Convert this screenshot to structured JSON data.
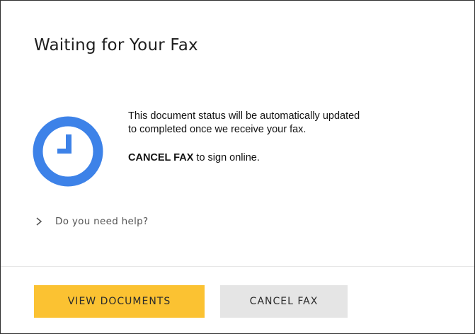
{
  "dialog": {
    "title": "Waiting for Your Fax",
    "status_icon": "clock-icon",
    "message_line1": "This document status will be automatically updated",
    "message_line2": "to completed once we receive your fax.",
    "cancel_emphasis": "CANCEL FAX",
    "cancel_suffix": " to sign online.",
    "help_label": "Do you need help?",
    "help_icon": "chevron-right-icon"
  },
  "actions": {
    "view_documents_label": "VIEW DOCUMENTS",
    "cancel_fax_label": "CANCEL FAX"
  },
  "colors": {
    "accent_blue": "#3d82e8",
    "primary_button": "#fbc232",
    "secondary_button": "#e5e5e5"
  }
}
